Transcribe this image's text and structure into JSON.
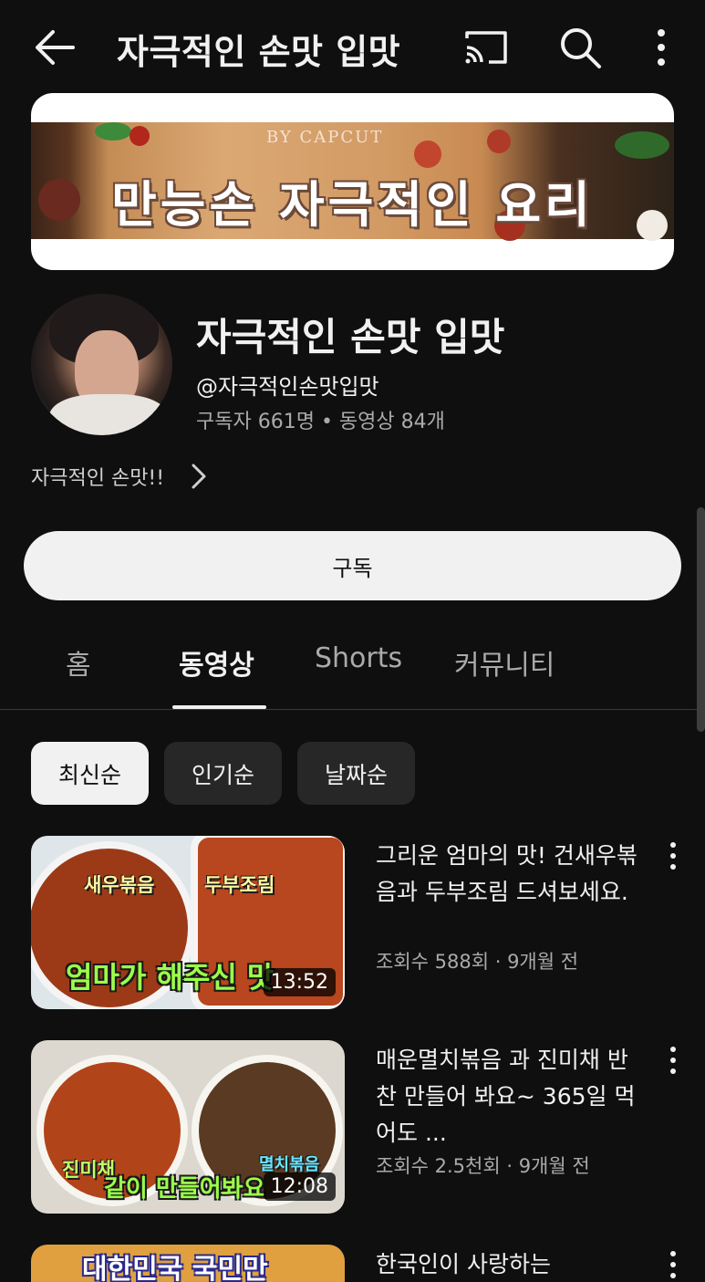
{
  "topbar": {
    "title": "자극적인 손맛 입맛",
    "icons": [
      "back-arrow-icon",
      "cast-icon",
      "search-icon",
      "more-vertical-icon"
    ]
  },
  "banner": {
    "brand": "BY CAPCUT",
    "headline": "만능손 자극적인 요리"
  },
  "channel": {
    "name": "자극적인 손맛 입맛",
    "handle": "@자극적인손맛입맛",
    "stats": "구독자 661명 • 동영상 84개",
    "description": "자극적인 손맛!!",
    "subscribe_label": "구독"
  },
  "tabs": [
    {
      "label": "홈",
      "active": false
    },
    {
      "label": "동영상",
      "active": true
    },
    {
      "label": "Shorts",
      "active": false
    },
    {
      "label": "커뮤니티",
      "active": false
    }
  ],
  "chips": [
    {
      "label": "최신순",
      "active": true
    },
    {
      "label": "인기순",
      "active": false
    },
    {
      "label": "날짜순",
      "active": false
    }
  ],
  "videos": [
    {
      "title": "그리운 엄마의 맛! 건새우볶음과 두부조림 드셔보세요.",
      "meta": "조회수 588회 · 9개월 전",
      "duration": "13:52",
      "thumb_labels": [
        "새우볶음",
        "두부조림",
        "엄마가 해주신 맛"
      ]
    },
    {
      "title": "매운멸치볶음 과 진미채 반찬 만들어 봐요~  365일 먹어도 ...",
      "meta": "조회수 2.5천회 · 9개월 전",
      "duration": "12:08",
      "thumb_labels": [
        "진미채",
        "멸치볶음",
        "같이 만들어봐요"
      ]
    },
    {
      "title": "한국인이 사랑하는",
      "meta": "",
      "duration": "",
      "thumb_labels": [
        "대한민국 국민만"
      ]
    }
  ],
  "colors": {
    "background": "#0f0f0f",
    "text_primary": "#f1f1f1",
    "text_secondary": "#aaaaaa",
    "chip_bg": "#272727",
    "subscribe_bg": "#f1f1f1"
  }
}
